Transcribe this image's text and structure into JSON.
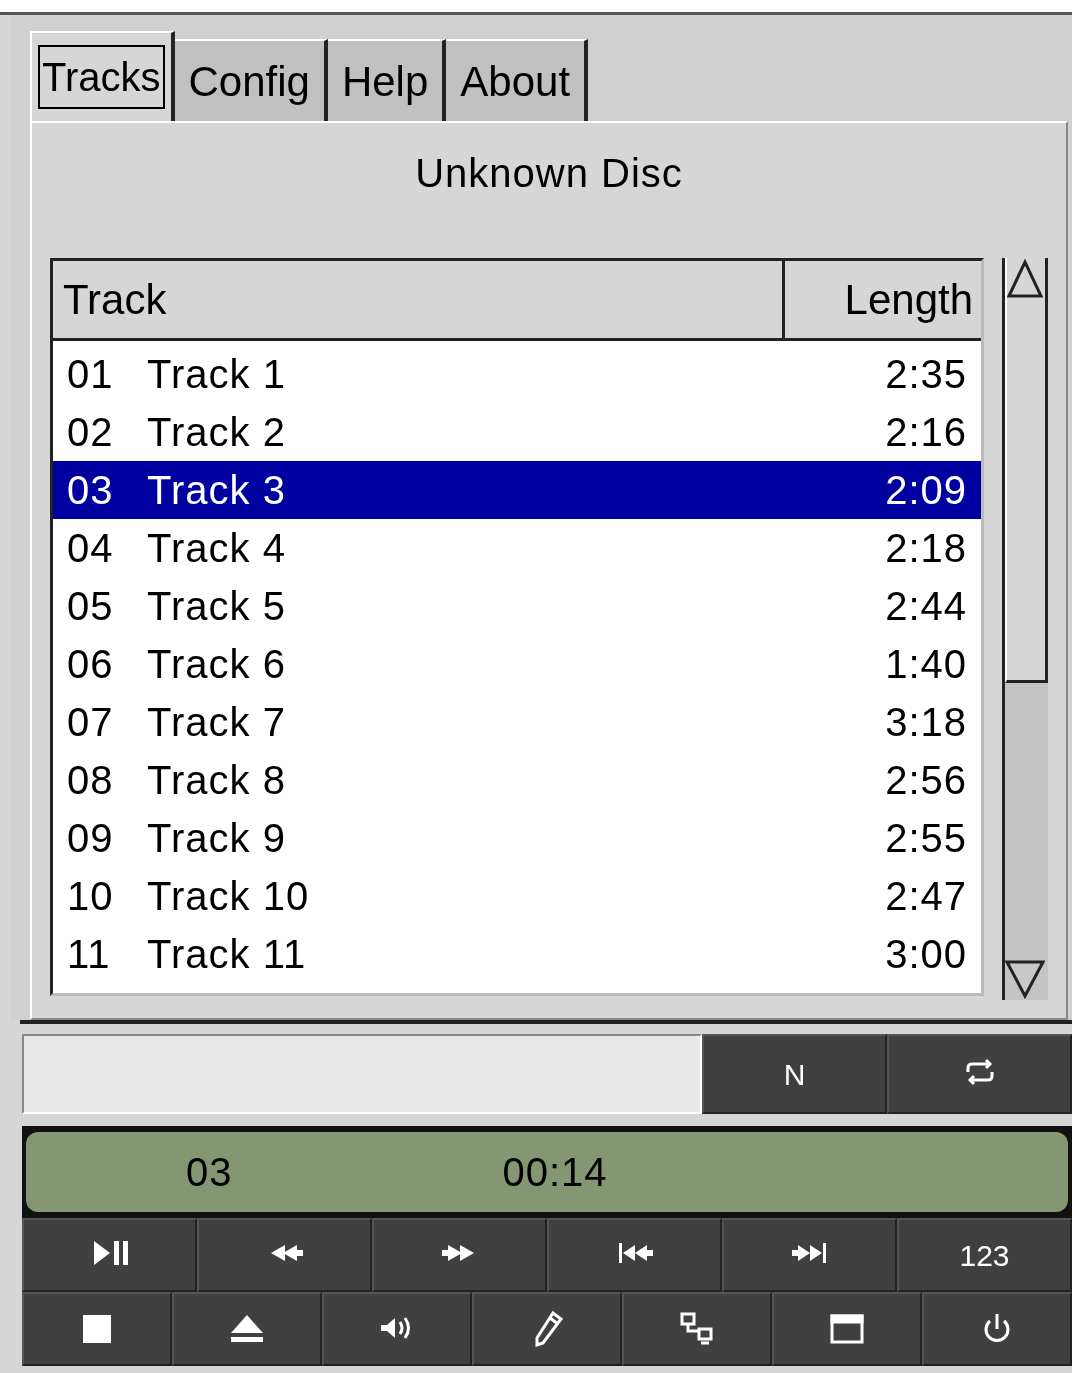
{
  "tabs": [
    {
      "label": "Tracks",
      "selected": true
    },
    {
      "label": "Config",
      "selected": false
    },
    {
      "label": "Help",
      "selected": false
    },
    {
      "label": "About",
      "selected": false
    }
  ],
  "disc_title": "Unknown Disc",
  "track_list": {
    "columns": [
      "Track",
      "Length"
    ],
    "rows": [
      {
        "number": "01",
        "title": "Track 1",
        "length": "2:35",
        "selected": false
      },
      {
        "number": "02",
        "title": "Track 2",
        "length": "2:16",
        "selected": false
      },
      {
        "number": "03",
        "title": "Track 3",
        "length": "2:09",
        "selected": true
      },
      {
        "number": "04",
        "title": "Track 4",
        "length": "2:18",
        "selected": false
      },
      {
        "number": "05",
        "title": "Track 5",
        "length": "2:44",
        "selected": false
      },
      {
        "number": "06",
        "title": "Track 6",
        "length": "1:40",
        "selected": false
      },
      {
        "number": "07",
        "title": "Track 7",
        "length": "3:18",
        "selected": false
      },
      {
        "number": "08",
        "title": "Track 8",
        "length": "2:56",
        "selected": false
      },
      {
        "number": "09",
        "title": "Track 9",
        "length": "2:55",
        "selected": false
      },
      {
        "number": "10",
        "title": "Track 10",
        "length": "2:47",
        "selected": false
      },
      {
        "number": "11",
        "title": "Track 11",
        "length": "3:00",
        "selected": false
      }
    ]
  },
  "mode_buttons": [
    {
      "kind": "text",
      "label": "N"
    },
    {
      "kind": "repeat"
    }
  ],
  "display": {
    "track": "03",
    "time": "00:14"
  },
  "transport_row": [
    {
      "kind": "play-pause"
    },
    {
      "kind": "rewind"
    },
    {
      "kind": "fast-forward"
    },
    {
      "kind": "previous"
    },
    {
      "kind": "next"
    },
    {
      "kind": "text",
      "label": "123"
    }
  ],
  "control_row": [
    {
      "kind": "stop"
    },
    {
      "kind": "eject"
    },
    {
      "kind": "volume"
    },
    {
      "kind": "pencil"
    },
    {
      "kind": "network"
    },
    {
      "kind": "window"
    },
    {
      "kind": "power"
    }
  ]
}
